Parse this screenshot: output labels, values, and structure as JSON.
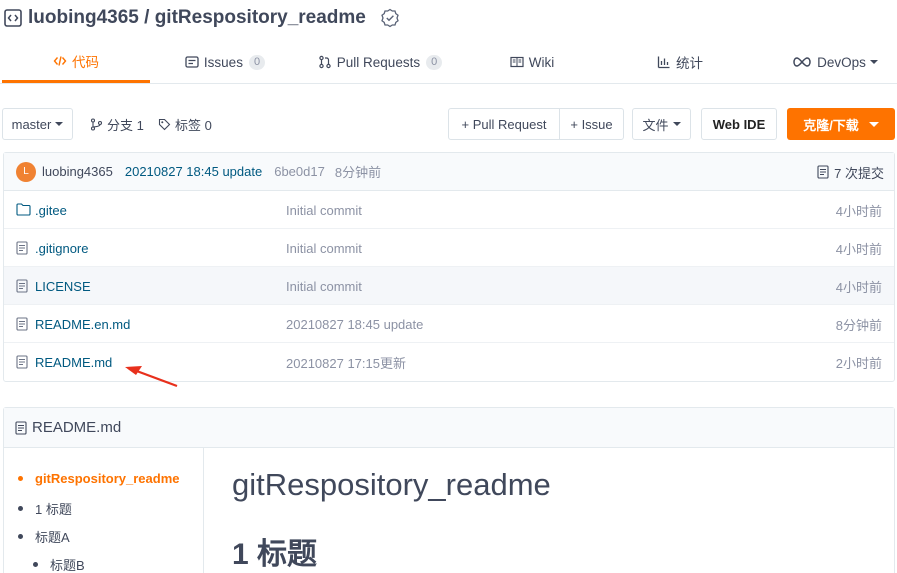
{
  "repo": {
    "title": "luobing4365 / gitRespository_readme"
  },
  "tabs": [
    {
      "label": "代码",
      "icon": "code-icon",
      "active": true
    },
    {
      "label": "Issues",
      "count": "0",
      "icon": "issues-icon"
    },
    {
      "label": "Pull Requests",
      "count": "0",
      "icon": "pull-request-icon"
    },
    {
      "label": "Wiki",
      "icon": "wiki-icon"
    },
    {
      "label": "统计",
      "icon": "stats-icon"
    },
    {
      "label": "DevOps",
      "icon": "devops-icon"
    }
  ],
  "toolbar": {
    "branch": "master",
    "branches_label": "分支 1",
    "tags_label": "标签 0",
    "pull_request_btn": "+ Pull Request",
    "issue_btn": "+ Issue",
    "file_btn": "文件",
    "web_ide_btn": "Web IDE",
    "clone_btn": "克隆/下载"
  },
  "commit": {
    "avatar_letter": "L",
    "author": "luobing4365",
    "message": "20210827 18:45 update",
    "sha": "6be0d17",
    "time": "8分钟前",
    "count_label": "7 次提交"
  },
  "files": [
    {
      "name": ".gitee",
      "type": "folder",
      "commit": "Initial commit",
      "time": "4小时前"
    },
    {
      "name": ".gitignore",
      "type": "file",
      "commit": "Initial commit",
      "time": "4小时前"
    },
    {
      "name": "LICENSE",
      "type": "file",
      "commit": "Initial commit",
      "time": "4小时前",
      "highlight": true
    },
    {
      "name": "README.en.md",
      "type": "file",
      "commit": "20210827 18:45 update",
      "time": "8分钟前"
    },
    {
      "name": "README.md",
      "type": "file",
      "commit": "20210827 17:15更新",
      "time": "2小时前"
    }
  ],
  "readme": {
    "filename": "README.md",
    "toc": [
      {
        "label": "gitRespository_readme",
        "active": true
      },
      {
        "label": "1 标题"
      },
      {
        "label": "标题A"
      },
      {
        "label": "标题B"
      }
    ],
    "h1": "gitRespository_readme",
    "h2": "1 标题"
  },
  "colors": {
    "accent": "#fe7300",
    "link": "#005980",
    "arrow": "#e8301c"
  }
}
